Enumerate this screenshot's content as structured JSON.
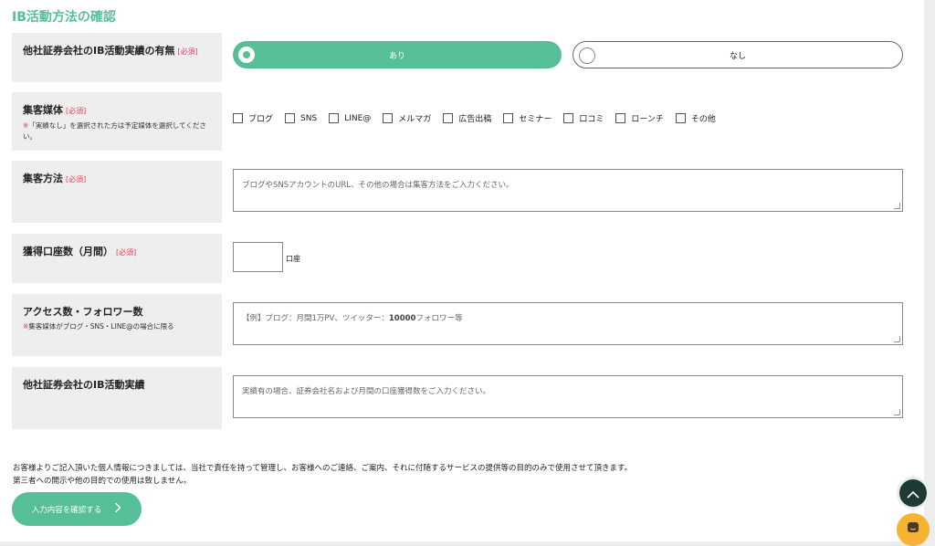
{
  "section": {
    "title": "IB活動方法の確認"
  },
  "required_tag": "[必須]",
  "rows": {
    "ib_experience": {
      "label": "他社証券会社のIB活動実績の有無",
      "options": {
        "yes": "あり",
        "no": "なし"
      },
      "selected": "yes"
    },
    "media": {
      "label": "集客媒体",
      "note_mark": "※",
      "note": "「実績なし」を選択された方は予定媒体を選択してください。",
      "options": [
        "ブログ",
        "SNS",
        "LINE@",
        "メルマガ",
        "広告出稿",
        "セミナー",
        "口コミ",
        "ローンチ",
        "その他"
      ]
    },
    "method": {
      "label": "集客方法",
      "placeholder": "ブログやSNSアカウントのURL、その他の場合は集客方法をご入力ください。"
    },
    "accounts": {
      "label": "獲得口座数（月間）",
      "unit": "口座"
    },
    "access": {
      "label": "アクセス数・フォロワー数",
      "note_mark": "※",
      "note": "集客媒体がブログ・SNS・LINE@の場合に限る",
      "placeholder_pre": "【例】ブログ：月間1万PV、ツイッター：",
      "placeholder_num": "10000",
      "placeholder_post": "フォロワー等"
    },
    "ib_record": {
      "label": "他社証券会社のIB活動実績",
      "placeholder": "実績有の場合、証券会社名および月間の口座獲得数をご入力ください。"
    }
  },
  "privacy": {
    "line1": "お客様よりご記入頂いた個人情報につきましては、当社で責任を持って管理し、お客様へのご連絡、ご案内、それに付随するサービスの提供等の目的のみで使用させて頂きます。",
    "line2": "第三者への開示や他の目的での使用は致しません。"
  },
  "buttons": {
    "confirm": "入力内容を確認する"
  },
  "icons": {
    "confirm_chevron": "chevron-right-icon",
    "scroll_top": "chevron-up-icon",
    "chat": "chat-icon"
  },
  "colors": {
    "accent": "#56bf98",
    "required": "#e0405e",
    "label_bg": "#eeeeee",
    "fab_dark": "#1f3a35",
    "fab_chat": "#f5b331"
  }
}
